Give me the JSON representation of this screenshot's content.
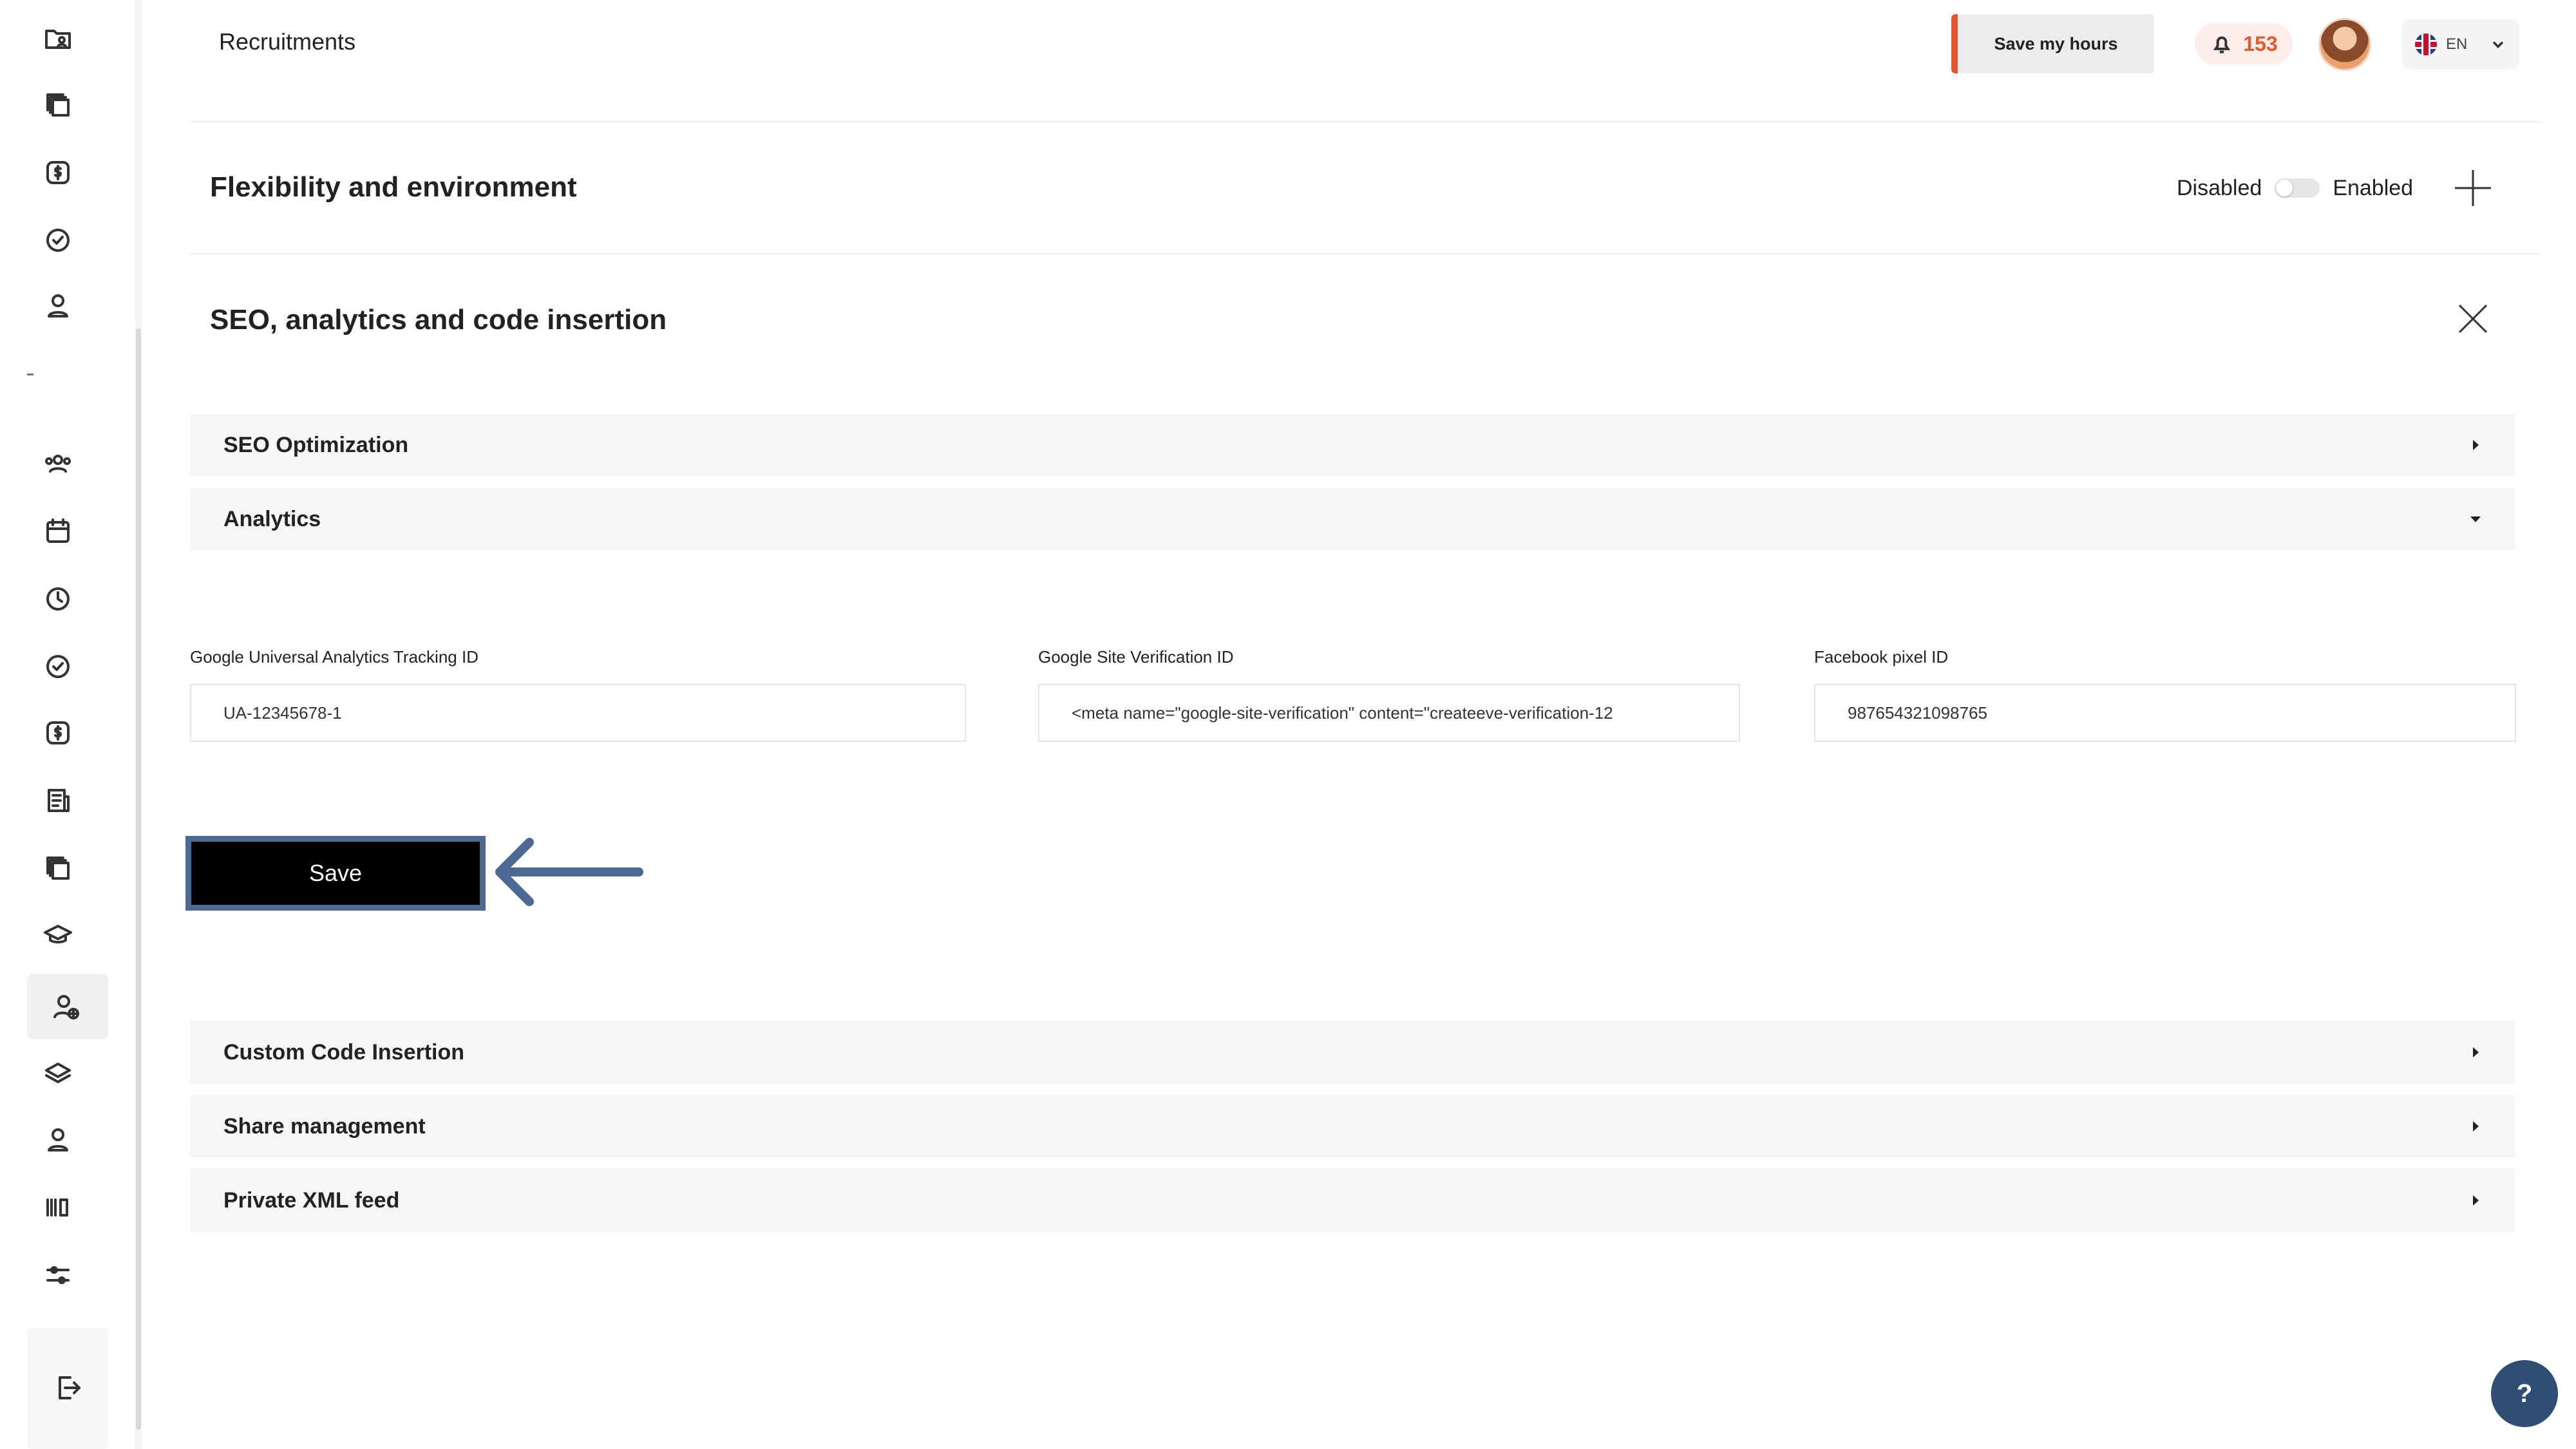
{
  "header": {
    "title": "Recruitments",
    "save_hours_label": "Save my hours",
    "notification_count": "153",
    "language_code": "EN"
  },
  "sections": {
    "flexibility": {
      "title": "Flexibility and environment",
      "toggle_disabled_label": "Disabled",
      "toggle_enabled_label": "Enabled",
      "enabled": false
    },
    "seo": {
      "title": "SEO, analytics and code insertion"
    }
  },
  "accordions": {
    "seo_optimization": "SEO Optimization",
    "analytics": "Analytics",
    "custom_code": "Custom Code Insertion",
    "share_management": "Share management",
    "private_xml": "Private XML feed"
  },
  "analytics_form": {
    "ga_label": "Google Universal Analytics Tracking ID",
    "ga_value": "UA-12345678-1",
    "gsv_label": "Google Site Verification ID",
    "gsv_value": "<meta name=\"google-site-verification\" content=\"createeve-verification-12",
    "fb_label": "Facebook pixel ID",
    "fb_value": "987654321098765",
    "save_label": "Save"
  },
  "help_label": "?",
  "colors": {
    "accent_orange": "#e4572e",
    "highlight_blue": "#4a6a94",
    "help_button": "#2f4e73"
  }
}
